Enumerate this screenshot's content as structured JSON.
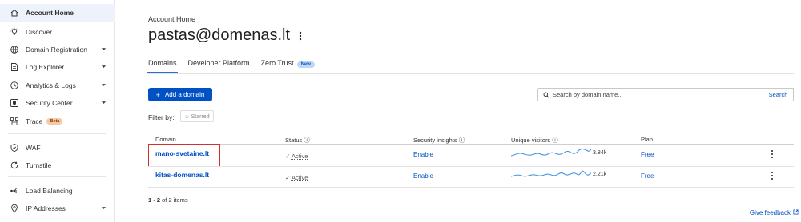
{
  "sidebar": {
    "items": [
      {
        "label": "Account Home",
        "icon": "home-icon",
        "active": true,
        "chevron": false,
        "badge": ""
      },
      {
        "label": "Discover",
        "icon": "lightbulb-icon",
        "active": false,
        "chevron": false,
        "badge": ""
      },
      {
        "label": "Domain Registration",
        "icon": "globe-icon",
        "active": false,
        "chevron": true,
        "badge": ""
      },
      {
        "label": "Log Explorer",
        "icon": "log-file-icon",
        "active": false,
        "chevron": true,
        "badge": ""
      },
      {
        "label": "Analytics & Logs",
        "icon": "clock-icon",
        "active": false,
        "chevron": true,
        "badge": ""
      },
      {
        "label": "Security Center",
        "icon": "shield-square-icon",
        "active": false,
        "chevron": true,
        "badge": ""
      },
      {
        "label": "Trace",
        "icon": "trace-network-icon",
        "active": false,
        "chevron": false,
        "badge": "Beta"
      },
      {
        "label": "WAF",
        "icon": "waf-shield-icon",
        "active": false,
        "chevron": false,
        "badge": ""
      },
      {
        "label": "Turnstile",
        "icon": "turnstile-refresh-icon",
        "active": false,
        "chevron": false,
        "badge": ""
      },
      {
        "label": "Load Balancing",
        "icon": "load-balancing-icon",
        "active": false,
        "chevron": false,
        "badge": ""
      },
      {
        "label": "IP Addresses",
        "icon": "location-pin-icon",
        "active": false,
        "chevron": true,
        "badge": ""
      }
    ]
  },
  "header": {
    "breadcrumb": "Account Home",
    "title": "pastas@domenas.lt"
  },
  "tabs": [
    {
      "label": "Domains",
      "active": true,
      "badge": ""
    },
    {
      "label": "Developer Platform",
      "active": false,
      "badge": ""
    },
    {
      "label": "Zero Trust",
      "active": false,
      "badge": "New"
    }
  ],
  "toolbar": {
    "add_domain_label": "Add a domain",
    "search_placeholder": "Search by domain name...",
    "search_button_label": "Search"
  },
  "filter": {
    "label": "Filter by:",
    "starred_label": "☆ Starred"
  },
  "table": {
    "columns": [
      "Domain",
      "Status ⓘ",
      "Security insights ⓘ",
      "Unique visitors ⓘ",
      "Plan"
    ],
    "rows": [
      {
        "domain": "mano-svetaine.lt",
        "status": "Active",
        "security": "Enable",
        "visitors": "3.84k",
        "plan": "Free",
        "highlighted": true
      },
      {
        "domain": "kitas-domenas.lt",
        "status": "Active",
        "security": "Enable",
        "visitors": "2.21k",
        "plan": "Free",
        "highlighted": false
      }
    ]
  },
  "pager": {
    "range": "1 - 2",
    "suffix": "of 2 items"
  },
  "feedback_label": "Give feedback",
  "colors": {
    "accent": "#0051c3",
    "active_nav_bg": "#eef3fb",
    "highlight_border": "#d62f2f",
    "sparkline": "#3b8fe0"
  }
}
